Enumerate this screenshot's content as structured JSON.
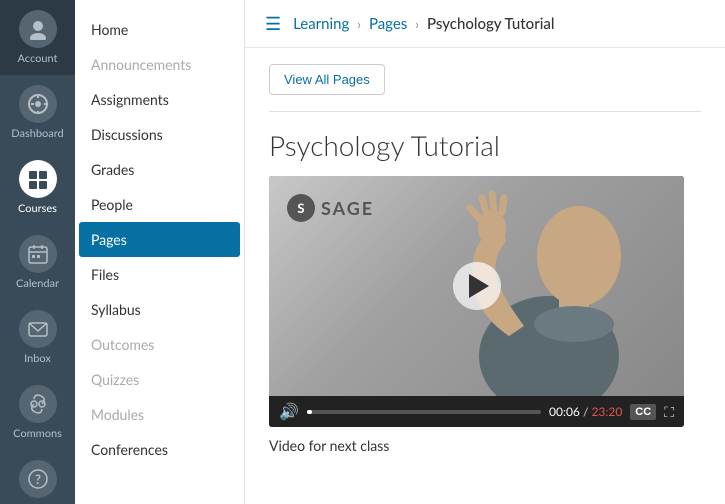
{
  "nav": {
    "items": [
      {
        "id": "account",
        "label": "Account",
        "icon": "👤",
        "active": false
      },
      {
        "id": "dashboard",
        "label": "Dashboard",
        "icon": "⊞",
        "active": false
      },
      {
        "id": "courses",
        "label": "Courses",
        "active": true
      },
      {
        "id": "calendar",
        "label": "Calendar",
        "icon": "📅",
        "active": false
      },
      {
        "id": "inbox",
        "label": "Inbox",
        "icon": "✉",
        "active": false
      },
      {
        "id": "commons",
        "label": "Commons",
        "icon": "↩",
        "active": false
      },
      {
        "id": "help",
        "label": "?",
        "active": false
      }
    ]
  },
  "sidebar": {
    "items": [
      {
        "id": "home",
        "label": "Home",
        "active": false,
        "muted": false
      },
      {
        "id": "announcements",
        "label": "Announcements",
        "active": false,
        "muted": true
      },
      {
        "id": "assignments",
        "label": "Assignments",
        "active": false,
        "muted": false
      },
      {
        "id": "discussions",
        "label": "Discussions",
        "active": false,
        "muted": false
      },
      {
        "id": "grades",
        "label": "Grades",
        "active": false,
        "muted": false
      },
      {
        "id": "people",
        "label": "People",
        "active": false,
        "muted": false
      },
      {
        "id": "pages",
        "label": "Pages",
        "active": true,
        "muted": false
      },
      {
        "id": "files",
        "label": "Files",
        "active": false,
        "muted": false
      },
      {
        "id": "syllabus",
        "label": "Syllabus",
        "active": false,
        "muted": false
      },
      {
        "id": "outcomes",
        "label": "Outcomes",
        "active": false,
        "muted": true
      },
      {
        "id": "quizzes",
        "label": "Quizzes",
        "active": false,
        "muted": true
      },
      {
        "id": "modules",
        "label": "Modules",
        "active": false,
        "muted": true
      },
      {
        "id": "conferences",
        "label": "Conferences",
        "active": false,
        "muted": false
      }
    ]
  },
  "breadcrumb": {
    "parts": [
      {
        "label": "Learning",
        "link": true
      },
      {
        "label": "Pages",
        "link": true
      },
      {
        "label": "Psychology Tutorial",
        "link": false
      }
    ]
  },
  "content": {
    "view_all_btn": "View All Pages",
    "page_title": "Psychology Tutorial",
    "sage_logo": "SAGE",
    "video_time_current": "00:06",
    "video_time_total": "23:20",
    "video_caption": "Video for next class"
  }
}
